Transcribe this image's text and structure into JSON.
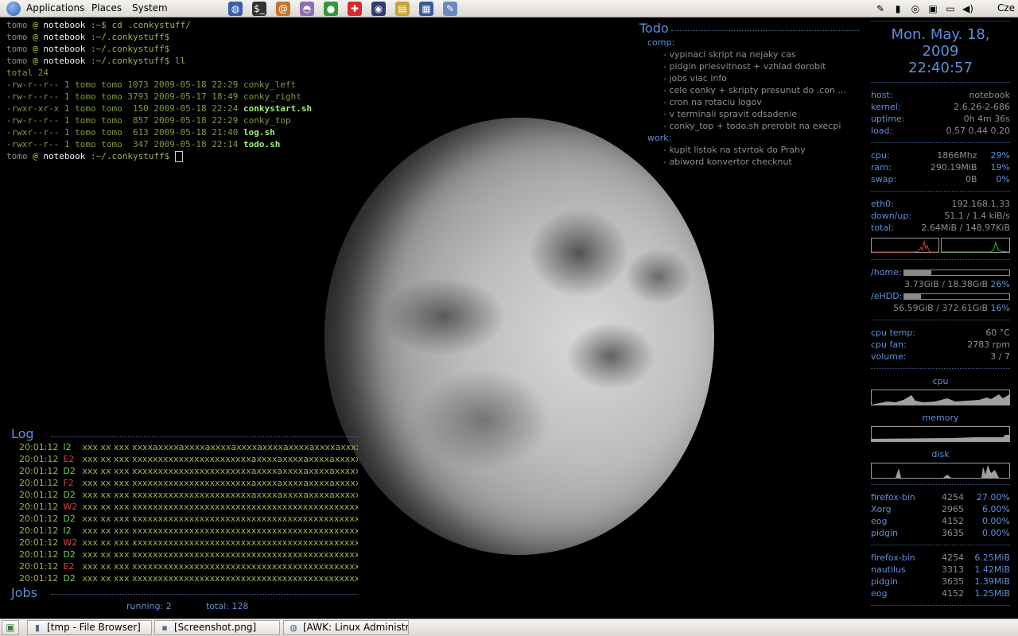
{
  "top_panel": {
    "menus": [
      "Applications",
      "Places",
      "System"
    ],
    "launchers": [
      {
        "icon": "web-browser-icon",
        "glyph": "◍",
        "color": "#3b5fa8"
      },
      {
        "icon": "terminal-icon",
        "glyph": "$_",
        "color": "#333333"
      },
      {
        "icon": "snail-icon",
        "glyph": "@",
        "color": "#c8752a"
      },
      {
        "icon": "pidgin-icon",
        "glyph": "◓",
        "color": "#8a6fb6"
      },
      {
        "icon": "green-alien-icon",
        "glyph": "●",
        "color": "#2f9a3a"
      },
      {
        "icon": "red-tools-icon",
        "glyph": "✚",
        "color": "#d82a2a"
      },
      {
        "icon": "globe-icon",
        "glyph": "◉",
        "color": "#2d3d7a"
      },
      {
        "icon": "graph-editor-icon",
        "glyph": "▤",
        "color": "#c9a335"
      },
      {
        "icon": "system-monitor-icon",
        "glyph": "▦",
        "color": "#3a5a9a"
      },
      {
        "icon": "text-editor-icon",
        "glyph": "✎",
        "color": "#6a89bf"
      }
    ],
    "tray": [
      {
        "icon": "notes-icon",
        "glyph": "✎"
      },
      {
        "icon": "battery-icon",
        "glyph": "▮"
      },
      {
        "icon": "network-status-icon",
        "glyph": "◎"
      },
      {
        "icon": "clipboard-icon",
        "glyph": "▣"
      },
      {
        "icon": "display-icon",
        "glyph": "▭"
      },
      {
        "icon": "volume-icon",
        "glyph": "◀)"
      }
    ],
    "keyboard_layout": "Cze"
  },
  "terminal": {
    "user": "tomo",
    "at": "@",
    "host": "notebook",
    "lines": [
      {
        "kind": "prompt",
        "path": " :~$ ",
        "cmd": "cd .conkystuff/"
      },
      {
        "kind": "prompt",
        "path": " :~/.conkystuff$",
        "cmd": ""
      },
      {
        "kind": "prompt",
        "path": " :~/.conkystuff$",
        "cmd": ""
      },
      {
        "kind": "prompt",
        "path": " :~/.conkystuff$ ",
        "cmd": "ll"
      },
      {
        "kind": "text",
        "text": "total 24"
      },
      {
        "kind": "file",
        "text": "-rw-r--r-- 1 tomo tomo 1073 2009-05-18 22:29 ",
        "name": "conky_left",
        "exec": false
      },
      {
        "kind": "file",
        "text": "-rw-r--r-- 1 tomo tomo 3793 2009-05-17 18:49 ",
        "name": "conky_right",
        "exec": false
      },
      {
        "kind": "file",
        "text": "-rwxr-xr-x 1 tomo tomo  150 2009-05-18 22:24 ",
        "name": "conkystart.sh",
        "exec": true
      },
      {
        "kind": "file",
        "text": "-rw-r--r-- 1 tomo tomo  857 2009-05-18 22:29 ",
        "name": "conky_top",
        "exec": false
      },
      {
        "kind": "file",
        "text": "-rwxr--r-- 1 tomo tomo  613 2009-05-18 21:40 ",
        "name": "log.sh",
        "exec": true
      },
      {
        "kind": "file",
        "text": "-rwxr--r-- 1 tomo tomo  347 2009-05-18 22:14 ",
        "name": "todo.sh",
        "exec": true
      },
      {
        "kind": "prompt",
        "path": " :~/.conkystuff$ ",
        "cmd": ""
      }
    ]
  },
  "todo": {
    "title": "Todo",
    "categories": [
      {
        "name": "comp:",
        "items": [
          "- vypinaci skript na nejaky cas",
          "- pidgin priesvitnost + vzhlad dorobit",
          "- jobs viac info",
          "- cele conky + skripty presunut do .con ...",
          "- cron na rotaciu logov",
          "- v terminali spravit odsadenie",
          "- conky_top + todo.sh prerobit na execpi"
        ]
      },
      {
        "name": "work:",
        "items": [
          "- kupit listok na stvrtok do Prahy",
          "- abiword konvertor checknut"
        ]
      }
    ]
  },
  "conky": {
    "date": "Mon. May. 18, 2009",
    "time": "22:40:57",
    "system": [
      {
        "label": "host:",
        "value": "notebook"
      },
      {
        "label": "kernel:",
        "value": "2.6.26-2-686"
      },
      {
        "label": "uptime:",
        "value": "0h 4m 36s"
      },
      {
        "label": "load:",
        "value": "0.57  0.44  0.20"
      }
    ],
    "resources": [
      {
        "label": "cpu:",
        "value": "1866Mhz",
        "pct": "29%"
      },
      {
        "label": "ram:",
        "value": "290.19MiB",
        "pct": "19%"
      },
      {
        "label": "swap:",
        "value": "0B",
        "pct": "0%"
      }
    ],
    "network": [
      {
        "label": "eth0:",
        "value": "192.168.1.33"
      },
      {
        "label": "down/up:",
        "value": "51.1 / 1.4 kiB/s"
      },
      {
        "label": "total:",
        "value": "2.64MiB / 148.97KiB"
      }
    ],
    "disks": [
      {
        "label": "/home:",
        "usage": "3.73GiB / 18.38GiB",
        "pct": "26%",
        "fill": 0.26
      },
      {
        "label": "/eHDD:",
        "usage": "56.59GiB / 372.61GiB",
        "pct": "16%",
        "fill": 0.16
      }
    ],
    "sensors": [
      {
        "label": "cpu temp:",
        "value": "60 °C"
      },
      {
        "label": "cpu fan:",
        "value": "2783 rpm"
      },
      {
        "label": "volume:",
        "value": "3 / 7"
      }
    ],
    "graphs": {
      "cpu": "cpu",
      "memory": "memory",
      "disk": "disk"
    },
    "top_cpu": [
      {
        "name": "firefox-bin",
        "pid": "4254",
        "value": "27.00%"
      },
      {
        "name": "Xorg",
        "pid": "2965",
        "value": "6.00%"
      },
      {
        "name": "eog",
        "pid": "4152",
        "value": "0.00%"
      },
      {
        "name": "pidgin",
        "pid": "3635",
        "value": "0.00%"
      }
    ],
    "top_mem": [
      {
        "name": "firefox-bin",
        "pid": "4254",
        "value": "6.25MiB"
      },
      {
        "name": "nautilus",
        "pid": "3313",
        "value": "1.42MiB"
      },
      {
        "name": "pidgin",
        "pid": "3635",
        "value": "1.39MiB"
      },
      {
        "name": "eog",
        "pid": "4152",
        "value": "1.25MiB"
      }
    ]
  },
  "log": {
    "title": "Log",
    "rows": [
      {
        "time": "20:01:12",
        "level": "I2",
        "msg": "xxx xx xxx xxxxaxxxxaxxxxaxxxxaxxxxaxxxxaxxxxaxxxxaxxxxaxxxxaxxxxaxxxxaxxxxaxxxx"
      },
      {
        "time": "20:01:12",
        "level": "E2",
        "msg": "xxx xx xxx xxxxxxxxxxxxxxxxxxxxxxxaxxxxaxxxxaxxxxaxxxxxxxxxxxxx"
      },
      {
        "time": "20:01:12",
        "level": "D2",
        "msg": "xxx xx xxx xxxxxxxxxxxxxxxxxxxxxxxaxxxxaxxxxaxxxxaxxxxxxxxxxxxx"
      },
      {
        "time": "20:01:12",
        "level": "F2",
        "msg": "xxx xx xxx xxxxxxxxxxxxxxxxxxxxxxxaxxxxaxxxxaxxxxaxxxxxxxxxxxxx"
      },
      {
        "time": "20:01:12",
        "level": "D2",
        "msg": "xxx xx xxx xxxxxxxxxxxxxxxxxxxxxxxaxxxxaxxxxaxxxxaxxxxxxxxxxxxx"
      },
      {
        "time": "20:01:12",
        "level": "W2",
        "msg": "xxx xx xxx xxxxxxxxxxxxxxxxxxxxxxxxxxxxxxxxxxxxxxxxxxxxxx..."
      },
      {
        "time": "20:01:12",
        "level": "D2",
        "msg": "xxx xx xxx xxxxxxxxxxxxxxxxxxxxxxxxxxxxxxxxxxxxxxxxxxxxxx..."
      },
      {
        "time": "20:01:12",
        "level": "I2",
        "msg": "xxx xx xxx xxxxxxxxxxxxxxxxxxxxxxxxxxxxxxxxxxxxxxxxxxxxxx..."
      },
      {
        "time": "20:01:12",
        "level": "W2",
        "msg": "xxx xx xxx xxxxxxxxxxxxxxxxxxxxxxxxxxxxxxxxxxxxxxxxxxxxxx..."
      },
      {
        "time": "20:01:12",
        "level": "D2",
        "msg": "xxx xx xxx xxxxxxxxxxxxxxxxxxxxxxxxxxxxxxxxxxxxxxxxxxxxxx"
      },
      {
        "time": "20:01:12",
        "level": "E2",
        "msg": "xxx xx xxx xxxxxxxxxxxxxxxxxxxxxxxxxxxxxxxxxxxxxxxxxxxxxx..."
      },
      {
        "time": "20:01:12",
        "level": "D2",
        "msg": "xxx xx xxx xxxxxxxxxxxxxxxxxxxxxxxxxxxxxxxxxxxxxxxxxxxxxx..."
      }
    ]
  },
  "jobs": {
    "title": "Jobs",
    "running": "running: 2",
    "total": "total: 128"
  },
  "taskbar": {
    "show_desktop_icon": "show-desktop-icon",
    "tasks": [
      {
        "icon": "folder-icon",
        "label": "[tmp - File Browser]"
      },
      {
        "icon": "image-icon",
        "label": "[Screenshot.png]"
      },
      {
        "icon": "web-browser-icon",
        "label": "[AWK: Linux Administr..."
      }
    ]
  }
}
